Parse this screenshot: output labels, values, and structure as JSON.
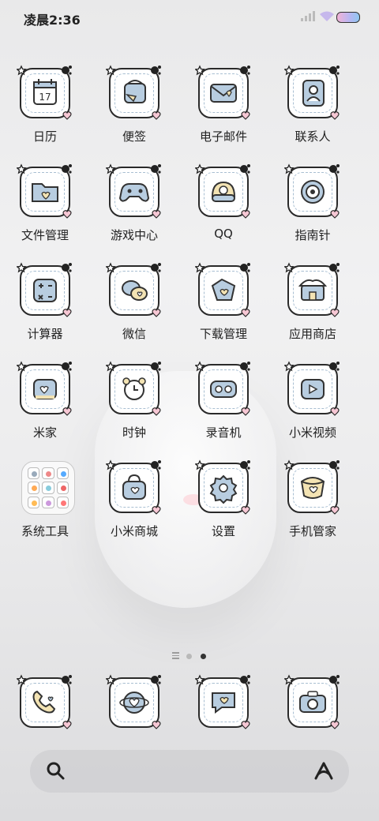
{
  "status_bar": {
    "time": "凌晨2:36",
    "battery_colors": [
      "#f2b3d6",
      "#b9b6f2",
      "#8fc7f1"
    ]
  },
  "apps": [
    {
      "label": "日历",
      "icon": "calendar-icon",
      "badge_text": "17"
    },
    {
      "label": "便签",
      "icon": "notes-icon"
    },
    {
      "label": "电子邮件",
      "icon": "mail-icon"
    },
    {
      "label": "联系人",
      "icon": "contacts-icon"
    },
    {
      "label": "文件管理",
      "icon": "folder-icon"
    },
    {
      "label": "游戏中心",
      "icon": "gamepad-icon"
    },
    {
      "label": "QQ",
      "icon": "qq-icon"
    },
    {
      "label": "指南针",
      "icon": "compass-icon"
    },
    {
      "label": "计算器",
      "icon": "calculator-icon"
    },
    {
      "label": "微信",
      "icon": "wechat-icon"
    },
    {
      "label": "下载管理",
      "icon": "download-icon"
    },
    {
      "label": "应用商店",
      "icon": "store-icon"
    },
    {
      "label": "米家",
      "icon": "home-icon"
    },
    {
      "label": "时钟",
      "icon": "clock-icon"
    },
    {
      "label": "录音机",
      "icon": "recorder-icon"
    },
    {
      "label": "小米视频",
      "icon": "video-icon"
    },
    {
      "label": "系统工具",
      "icon": "folder-grid-icon"
    },
    {
      "label": "小米商城",
      "icon": "shop-bag-icon"
    },
    {
      "label": "设置",
      "icon": "gear-icon"
    },
    {
      "label": "手机管家",
      "icon": "security-icon"
    }
  ],
  "dock": [
    {
      "icon": "phone-icon"
    },
    {
      "icon": "browser-icon"
    },
    {
      "icon": "messages-icon"
    },
    {
      "icon": "camera-icon"
    }
  ],
  "pages": {
    "count": 2,
    "active": 2
  },
  "search_bar": {
    "left_icon": "search-icon",
    "right_icon": "assistant-icon"
  },
  "colors": {
    "tile_fill": "#ffffff",
    "tile_border": "#2a2a2a",
    "dash": "#a9bfd2",
    "accent_blue": "#b8cde0",
    "accent_yellow": "#f3e3b3",
    "accent_pink": "#f6c7d4"
  }
}
